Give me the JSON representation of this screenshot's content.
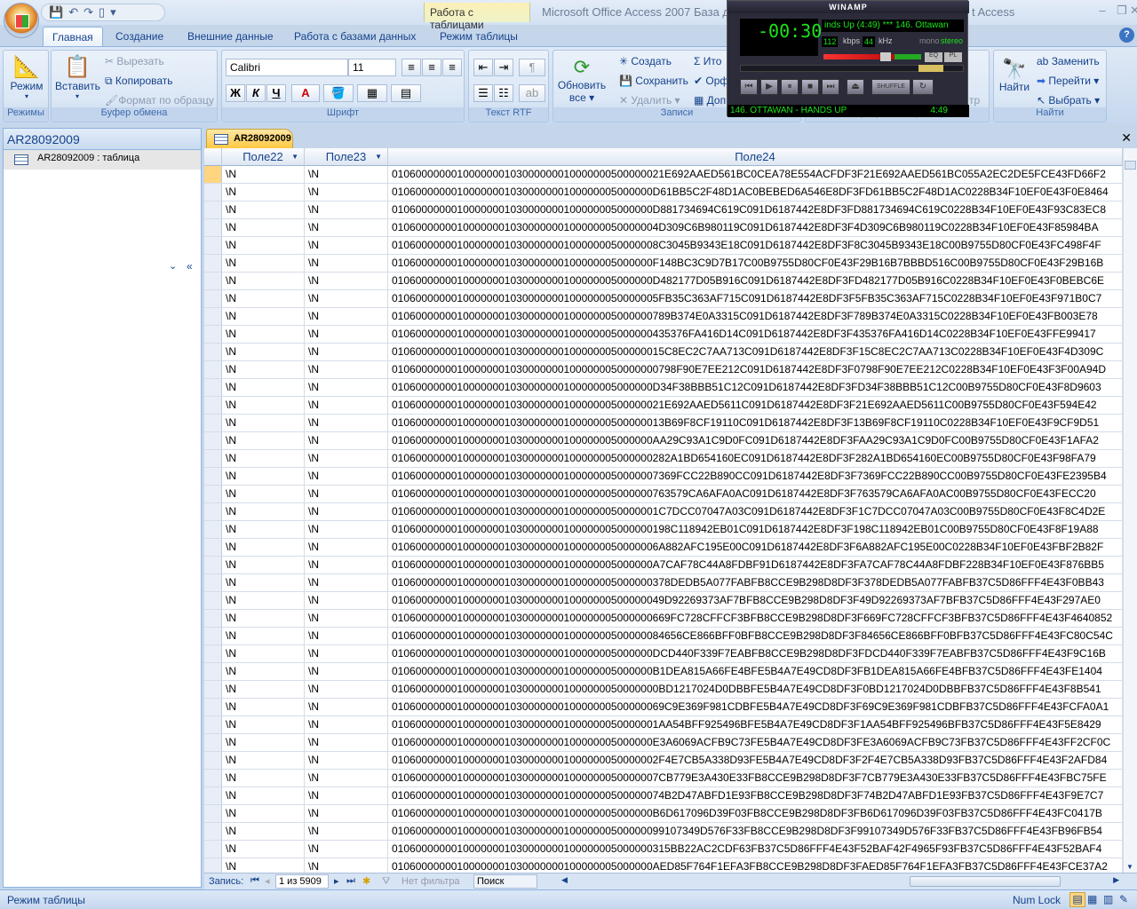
{
  "window": {
    "title_left": "Microsoft Office Access 2007 База д",
    "title_right": "t Access",
    "context_tab": "Работа с таблицами",
    "minimize": "–",
    "restore": "❐",
    "close": "✕"
  },
  "ribbon_tabs": [
    "Главная",
    "Создание",
    "Внешние данные",
    "Работа с базами данных",
    "Режим таблицы"
  ],
  "help": "?",
  "groups": {
    "modes": {
      "label": "Режимы",
      "view": "Режим"
    },
    "clipboard": {
      "label": "Буфер обмена",
      "paste": "Вставить",
      "cut": "Вырезать",
      "copy": "Копировать",
      "format_painter": "Формат по образцу"
    },
    "font": {
      "label": "Шрифт",
      "font_name": "Calibri",
      "font_size": "11",
      "bold": "Ж",
      "italic": "К",
      "underline": "Ч",
      "font_color": "A"
    },
    "rtf": {
      "label": "Текст RTF"
    },
    "records": {
      "label": "Записи",
      "refresh": "Обновить",
      "refresh2": "все",
      "new": "Создать",
      "save": "Сохранить",
      "delete": "Удалить",
      "totals": "Ито",
      "spelling": "Орф",
      "more": "Доп"
    },
    "sort": {
      "label": "Сортировка и фильтр",
      "partial": "тр"
    },
    "find": {
      "label": "Найти",
      "find": "Найти",
      "replace": "Заменить",
      "goto": "Перейти",
      "select": "Выбрать"
    }
  },
  "winamp": {
    "title": "WINAMP",
    "time": "-00:30",
    "song_scroll": "inds Up (4:49) *** 146. Ottawan",
    "kbps": "112",
    "kbps_label": "kbps",
    "khz": "44",
    "khz_label": "kHz",
    "mono": "mono",
    "stereo": "stereo",
    "eq": "EQ",
    "pl": "PL",
    "shuffle": "SHUFFLE",
    "track": "146. OTTAWAN - HANDS UP",
    "duration": "4:49",
    "volume_percent": 80,
    "position_percent": 20
  },
  "nav_pane": {
    "title": "AR28092009",
    "item": "AR28092009 : таблица"
  },
  "doc_tab": "AR28092009",
  "columns": [
    "Поле22",
    "Поле23",
    "Поле24"
  ],
  "prefix": "01060000000100000001030000000100000005000000",
  "rows": [
    [
      "\\N",
      "\\N",
      "0106000000010000000103000000010000000500000021E692AAED561BC0CEA78E554ACFDF3F21E692AAED561BC055A2EC2DE5FCE43FD66F2"
    ],
    [
      "\\N",
      "\\N",
      "01060000000100000001030000000100000005000000D61BB5C2F48D1AC0BEBED6A546E8DF3FD61BB5C2F48D1AC0228B34F10EF0E43F0E8464"
    ],
    [
      "\\N",
      "\\N",
      "01060000000100000001030000000100000005000000D881734694C619C091D6187442E8DF3FD881734694C619C0228B34F10EF0E43F93C83EC8"
    ],
    [
      "\\N",
      "\\N",
      "010600000001000000010300000001000000050000004D309C6B980119C091D6187442E8DF3F4D309C6B980119C0228B34F10EF0E43F85984BA"
    ],
    [
      "\\N",
      "\\N",
      "010600000001000000010300000001000000050000008C3045B9343E18C091D6187442E8DF3F8C3045B9343E18C00B9755D80CF0E43FC498F4F"
    ],
    [
      "\\N",
      "\\N",
      "01060000000100000001030000000100000005000000F148BC3C9D7B17C00B9755D80CF0E43F29B16B7BBBD516C00B9755D80CF0E43F29B16B"
    ],
    [
      "\\N",
      "\\N",
      "01060000000100000001030000000100000005000000D482177D05B916C091D6187442E8DF3FD482177D05B916C0228B34F10EF0E43F0BEBC6E"
    ],
    [
      "\\N",
      "\\N",
      "010600000001000000010300000001000000050000005FB35C363AF715C091D6187442E8DF3F5FB35C363AF715C0228B34F10EF0E43F971B0C7"
    ],
    [
      "\\N",
      "\\N",
      "01060000000100000001030000000100000005000000789B374E0A3315C091D6187442E8DF3F789B374E0A3315C0228B34F10EF0E43FB003E78"
    ],
    [
      "\\N",
      "\\N",
      "01060000000100000001030000000100000005000000435376FA416D14C091D6187442E8DF3F435376FA416D14C0228B34F10EF0E43FFE99417"
    ],
    [
      "\\N",
      "\\N",
      "0106000000010000000103000000010000000500000015C8EC2C7AA713C091D6187442E8DF3F15C8EC2C7AA713C0228B34F10EF0E43F4D309C"
    ],
    [
      "\\N",
      "\\N",
      "010600000001000000010300000001000000050000000798F90E7EE212C091D6187442E8DF3F0798F90E7EE212C0228B34F10EF0E43F3F00A94D"
    ],
    [
      "\\N",
      "\\N",
      "01060000000100000001030000000100000005000000D34F38BBB51C12C091D6187442E8DF3FD34F38BBB51C12C00B9755D80CF0E43F8D9603"
    ],
    [
      "\\N",
      "\\N",
      "0106000000010000000103000000010000000500000021E692AAED5611C091D6187442E8DF3F21E692AAED5611C00B9755D80CF0E43F594E42"
    ],
    [
      "\\N",
      "\\N",
      "0106000000010000000103000000010000000500000013B69F8CF19110C091D6187442E8DF3F13B69F8CF19110C0228B34F10EF0E43F9CF9D51"
    ],
    [
      "\\N",
      "\\N",
      "01060000000100000001030000000100000005000000AA29C93A1C9D0FC091D6187442E8DF3FAA29C93A1C9D0FC00B9755D80CF0E43F1AFA2"
    ],
    [
      "\\N",
      "\\N",
      "01060000000100000001030000000100000005000000282A1BD654160EC091D6187442E8DF3F282A1BD654160EC00B9755D80CF0E43F98FA79"
    ],
    [
      "\\N",
      "\\N",
      "010600000001000000010300000001000000050000007369FCC22B890CC091D6187442E8DF3F7369FCC22B890CC00B9755D80CF0E43FE2395B4"
    ],
    [
      "\\N",
      "\\N",
      "01060000000100000001030000000100000005000000763579CA6AFA0AC091D6187442E8DF3F763579CA6AFA0AC00B9755D80CF0E43FECC20"
    ],
    [
      "\\N",
      "\\N",
      "010600000001000000010300000001000000050000001C7DCC07047A03C091D6187442E8DF3F1C7DCC07047A03C00B9755D80CF0E43F8C4D2E"
    ],
    [
      "\\N",
      "\\N",
      "01060000000100000001030000000100000005000000198C118942EB01C091D6187442E8DF3F198C118942EB01C00B9755D80CF0E43F8F19A88"
    ],
    [
      "\\N",
      "\\N",
      "010600000001000000010300000001000000050000006A882AFC195E00C091D6187442E8DF3F6A882AFC195E00C0228B34F10EF0E43FBF2B82F"
    ],
    [
      "\\N",
      "\\N",
      "01060000000100000001030000000100000005000000A7CAF78C44A8FDBF91D6187442E8DF3FA7CAF78C44A8FDBF228B34F10EF0E43F876BB5"
    ],
    [
      "\\N",
      "\\N",
      "01060000000100000001030000000100000005000000378DEDB5A077FABFB8CCE9B298D8DF3F378DEDB5A077FABFB37C5D86FFF4E43F0BB43"
    ],
    [
      "\\N",
      "\\N",
      "0106000000010000000103000000010000000500000049D92269373AF7BFB8CCE9B298D8DF3F49D92269373AF7BFB37C5D86FFF4E43F297AE0"
    ],
    [
      "\\N",
      "\\N",
      "01060000000100000001030000000100000005000000669FC728CFFCF3BFB8CCE9B298D8DF3F669FC728CFFCF3BFB37C5D86FFF4E43F4640852"
    ],
    [
      "\\N",
      "\\N",
      "0106000000010000000103000000010000000500000084656CE866BFF0BFB8CCE9B298D8DF3F84656CE866BFF0BFB37C5D86FFF4E43FC80C54C"
    ],
    [
      "\\N",
      "\\N",
      "01060000000100000001030000000100000005000000DCD440F339F7EABFB8CCE9B298D8DF3FDCD440F339F7EABFB37C5D86FFF4E43F9C16B"
    ],
    [
      "\\N",
      "\\N",
      "01060000000100000001030000000100000005000000B1DEA815A66FE4BFE5B4A7E49CD8DF3FB1DEA815A66FE4BFB37C5D86FFF4E43FE1404"
    ],
    [
      "\\N",
      "\\N",
      "010600000001000000010300000001000000050000000BD1217024D0DBBFE5B4A7E49CD8DF3F0BD1217024D0DBBFB37C5D86FFF4E43F8B541"
    ],
    [
      "\\N",
      "\\N",
      "0106000000010000000103000000010000000500000069C9E369F981CDBFE5B4A7E49CD8DF3F69C9E369F981CDBFB37C5D86FFF4E43FCFA0A1"
    ],
    [
      "\\N",
      "\\N",
      "010600000001000000010300000001000000050000001AA54BFF925496BFE5B4A7E49CD8DF3F1AA54BFF925496BFB37C5D86FFF4E43F5E8429"
    ],
    [
      "\\N",
      "\\N",
      "01060000000100000001030000000100000005000000E3A6069ACFB9C73FE5B4A7E49CD8DF3FE3A6069ACFB9C73FB37C5D86FFF4E43FF2CF0C"
    ],
    [
      "\\N",
      "\\N",
      "010600000001000000010300000001000000050000002F4E7CB5A338D93FE5B4A7E49CD8DF3F2F4E7CB5A338D93FB37C5D86FFF4E43F2AFD84"
    ],
    [
      "\\N",
      "\\N",
      "010600000001000000010300000001000000050000007CB779E3A430E33FB8CCE9B298D8DF3F7CB779E3A430E33FB37C5D86FFF4E43FBC75FE"
    ],
    [
      "\\N",
      "\\N",
      "0106000000010000000103000000010000000500000074B2D47ABFD1E93FB8CCE9B298D8DF3F74B2D47ABFD1E93FB37C5D86FFF4E43F9E7C7"
    ],
    [
      "\\N",
      "\\N",
      "01060000000100000001030000000100000005000000B6D617096D39F03FB8CCE9B298D8DF3FB6D617096D39F03FB37C5D86FFF4E43FC0417B"
    ],
    [
      "\\N",
      "\\N",
      "0106000000010000000103000000010000000500000099107349D576F33FB8CCE9B298D8DF3F99107349D576F33FB37C5D86FFF4E43FB96FB54"
    ],
    [
      "\\N",
      "\\N",
      "01060000000100000001030000000100000005000000315BB22AC2CDF63FB37C5D86FFF4E43F52BAF42F4965F93FB37C5D86FFF4E43F52BAF4"
    ],
    [
      "\\N",
      "\\N",
      "01060000000100000001030000000100000005000000AED85F764F1EFA3FB8CCE9B298D8DF3FAED85F764F1EFA3FB37C5D86FFF4E43FCE37A2"
    ]
  ],
  "record_nav": {
    "label": "Запись:",
    "current": "1 из 5909",
    "no_filter": "Нет фильтра",
    "search": "Поиск"
  },
  "status": {
    "mode": "Режим таблицы",
    "numlock": "Num Lock"
  },
  "colors": {
    "accent": "#15428b",
    "active_tab": "#ffc843",
    "winamp_green": "#19e619"
  }
}
